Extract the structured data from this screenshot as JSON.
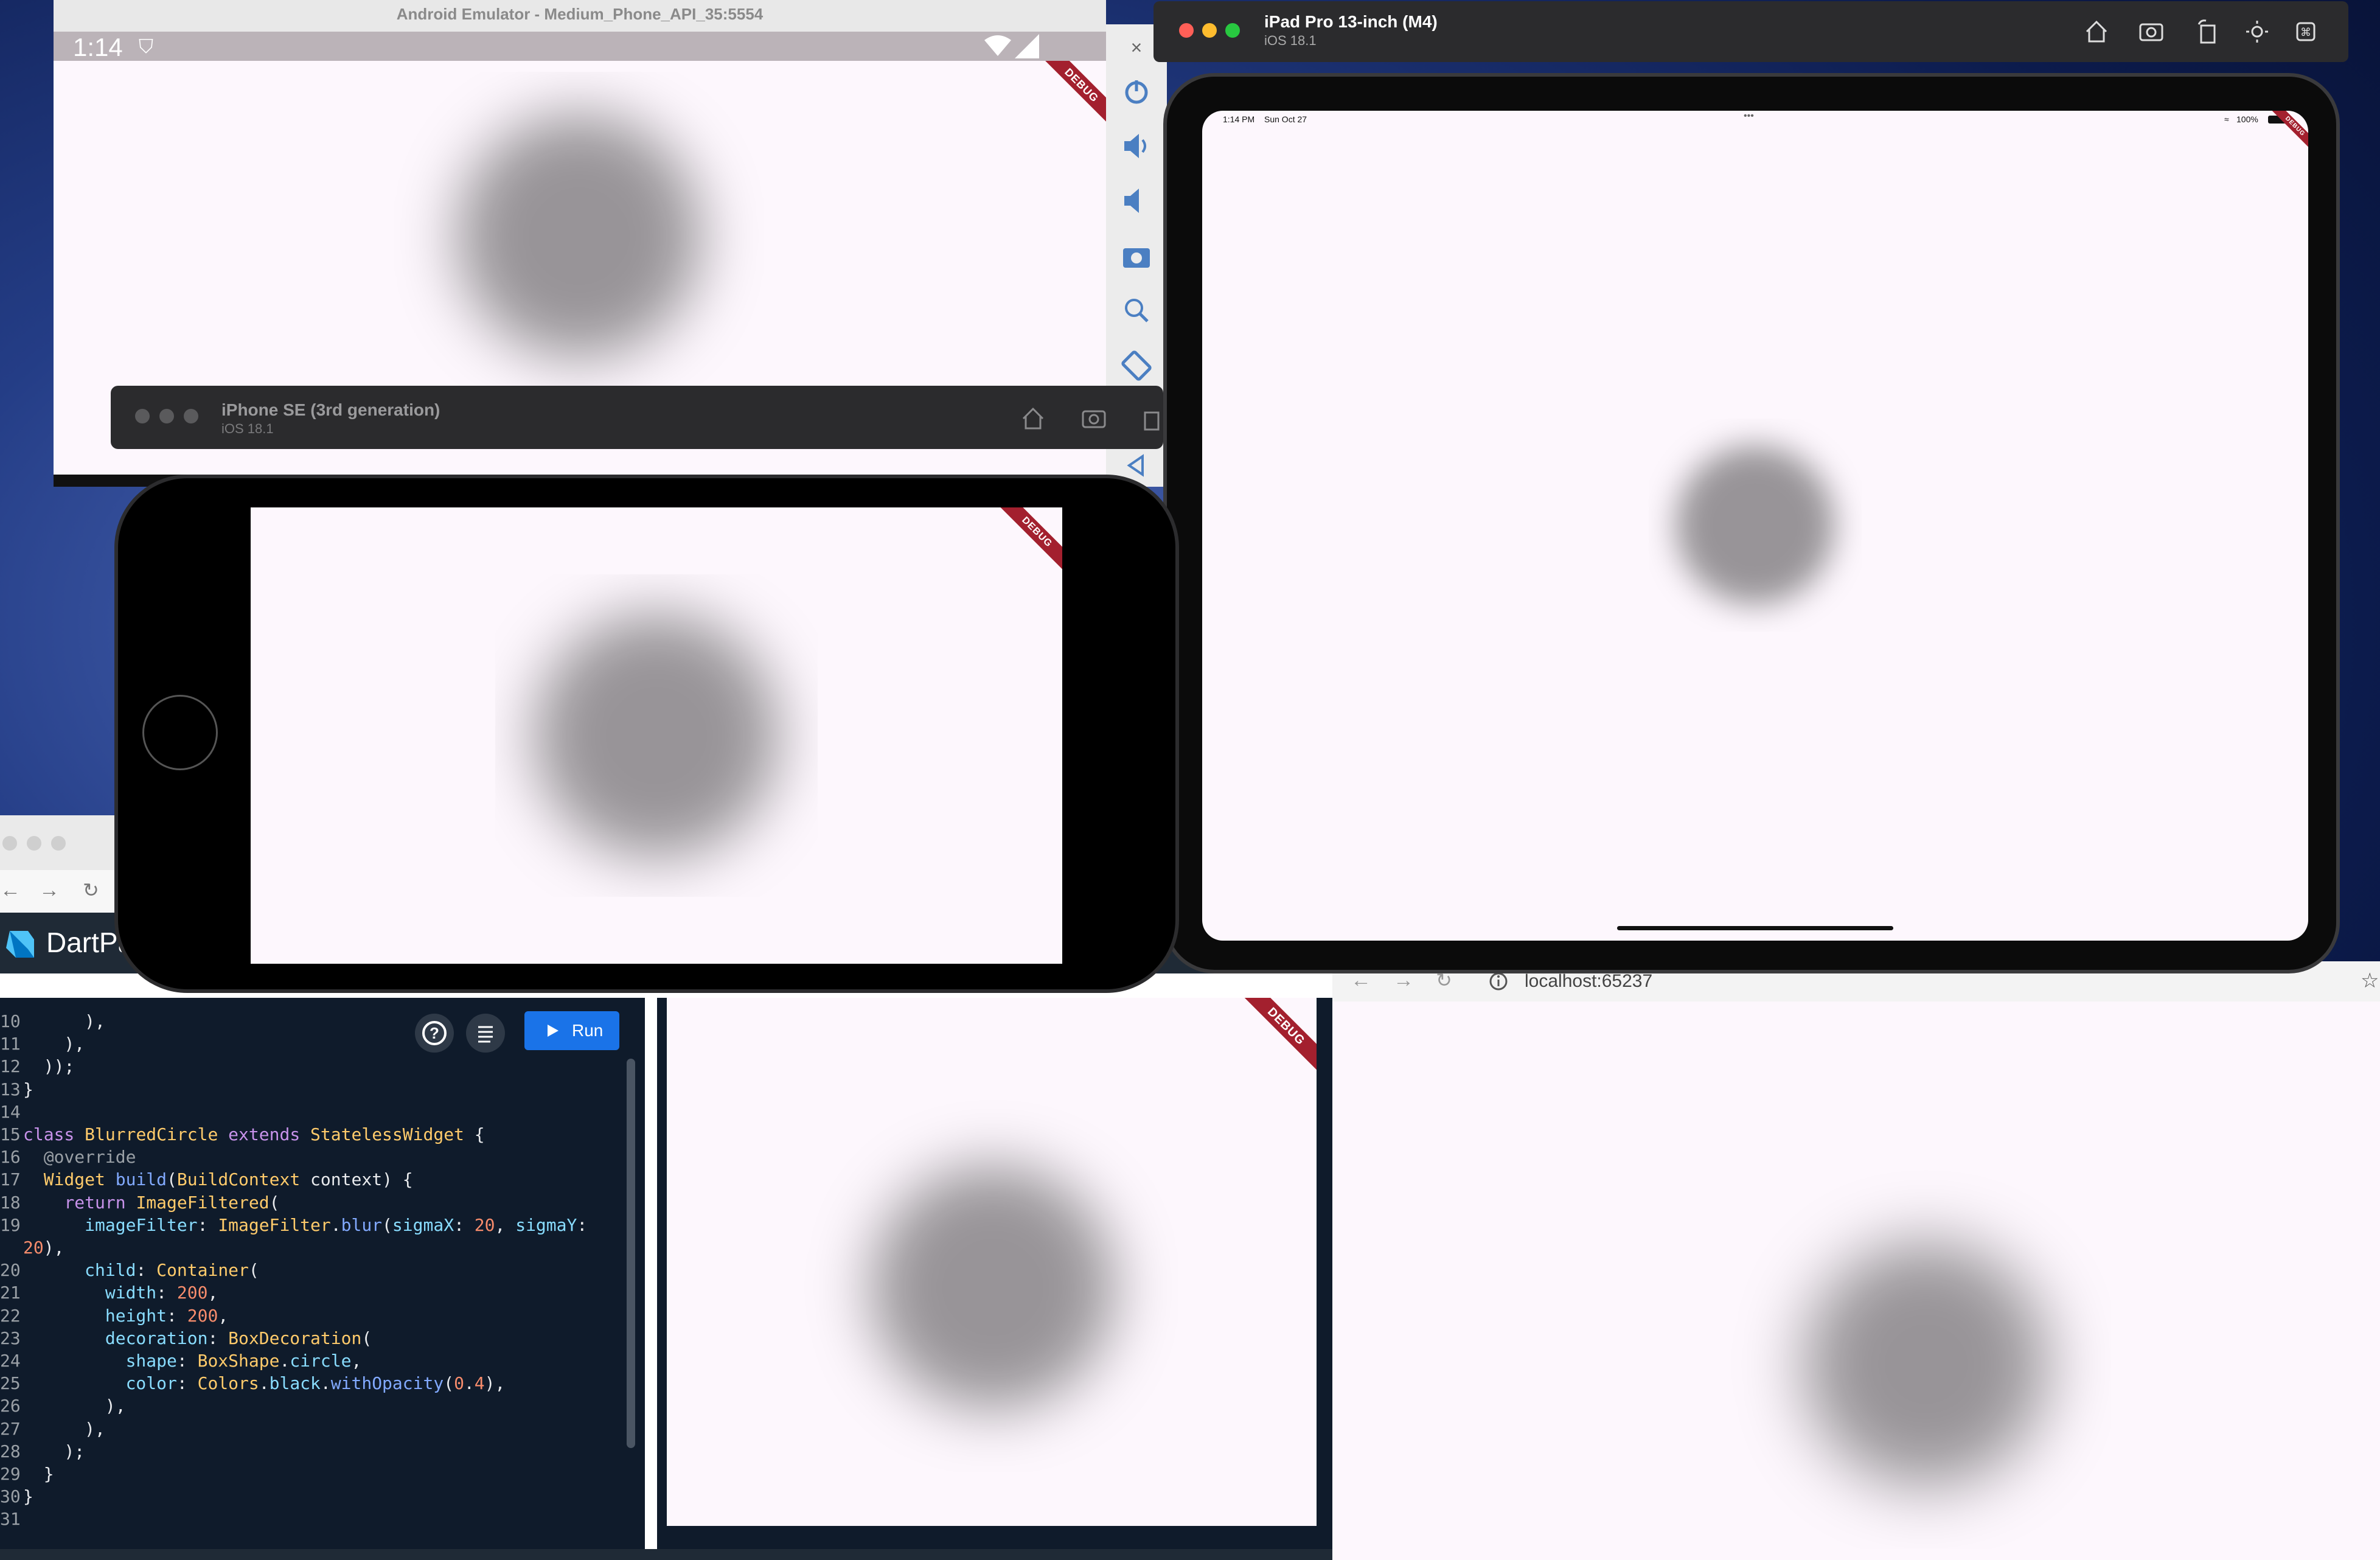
{
  "android": {
    "title": "Android Emulator - Medium_Phone_API_35:5554",
    "time": "1:14",
    "debug": "DEBUG",
    "side_icons": [
      "close-icon",
      "power-icon",
      "volume-up-icon",
      "volume-down-icon",
      "camera-icon",
      "zoom-icon",
      "rotate-icon",
      "back-icon"
    ]
  },
  "iphone": {
    "device": "iPhone SE (3rd generation)",
    "os": "iOS 18.1",
    "debug": "DEBUG"
  },
  "ipad": {
    "device": "iPad Pro 13-inch (M4)",
    "os": "iOS 18.1",
    "time": "1:14 PM",
    "date": "Sun Oct 27",
    "dots": "•••",
    "battery": "100%",
    "debug": "DEBUG"
  },
  "dartpad": {
    "brand": "DartPa",
    "run_label": "Run",
    "debug": "DEBUG",
    "code": [
      {
        "n": "10",
        "t": "      ),"
      },
      {
        "n": "11",
        "t": "    ),"
      },
      {
        "n": "12",
        "t": "  ));"
      },
      {
        "n": "13",
        "t": "}"
      },
      {
        "n": "14",
        "t": ""
      },
      {
        "n": "15",
        "t": "class BlurredCircle extends StatelessWidget {"
      },
      {
        "n": "16",
        "t": "  @override"
      },
      {
        "n": "17",
        "t": "  Widget build(BuildContext context) {"
      },
      {
        "n": "18",
        "t": "    return ImageFiltered("
      },
      {
        "n": "19",
        "t": "      imageFilter: ImageFilter.blur(sigmaX: 20, sigmaY:"
      },
      {
        "n": "",
        "t": "20),"
      },
      {
        "n": "20",
        "t": "      child: Container("
      },
      {
        "n": "21",
        "t": "        width: 200,"
      },
      {
        "n": "22",
        "t": "        height: 200,"
      },
      {
        "n": "23",
        "t": "        decoration: BoxDecoration("
      },
      {
        "n": "24",
        "t": "          shape: BoxShape.circle,"
      },
      {
        "n": "25",
        "t": "          color: Colors.black.withOpacity(0.4),"
      },
      {
        "n": "26",
        "t": "        ),"
      },
      {
        "n": "27",
        "t": "      ),"
      },
      {
        "n": "28",
        "t": "    );"
      },
      {
        "n": "29",
        "t": "  }"
      },
      {
        "n": "30",
        "t": "}"
      },
      {
        "n": "31",
        "t": ""
      }
    ]
  },
  "browser": {
    "url": "localhost:65237"
  }
}
